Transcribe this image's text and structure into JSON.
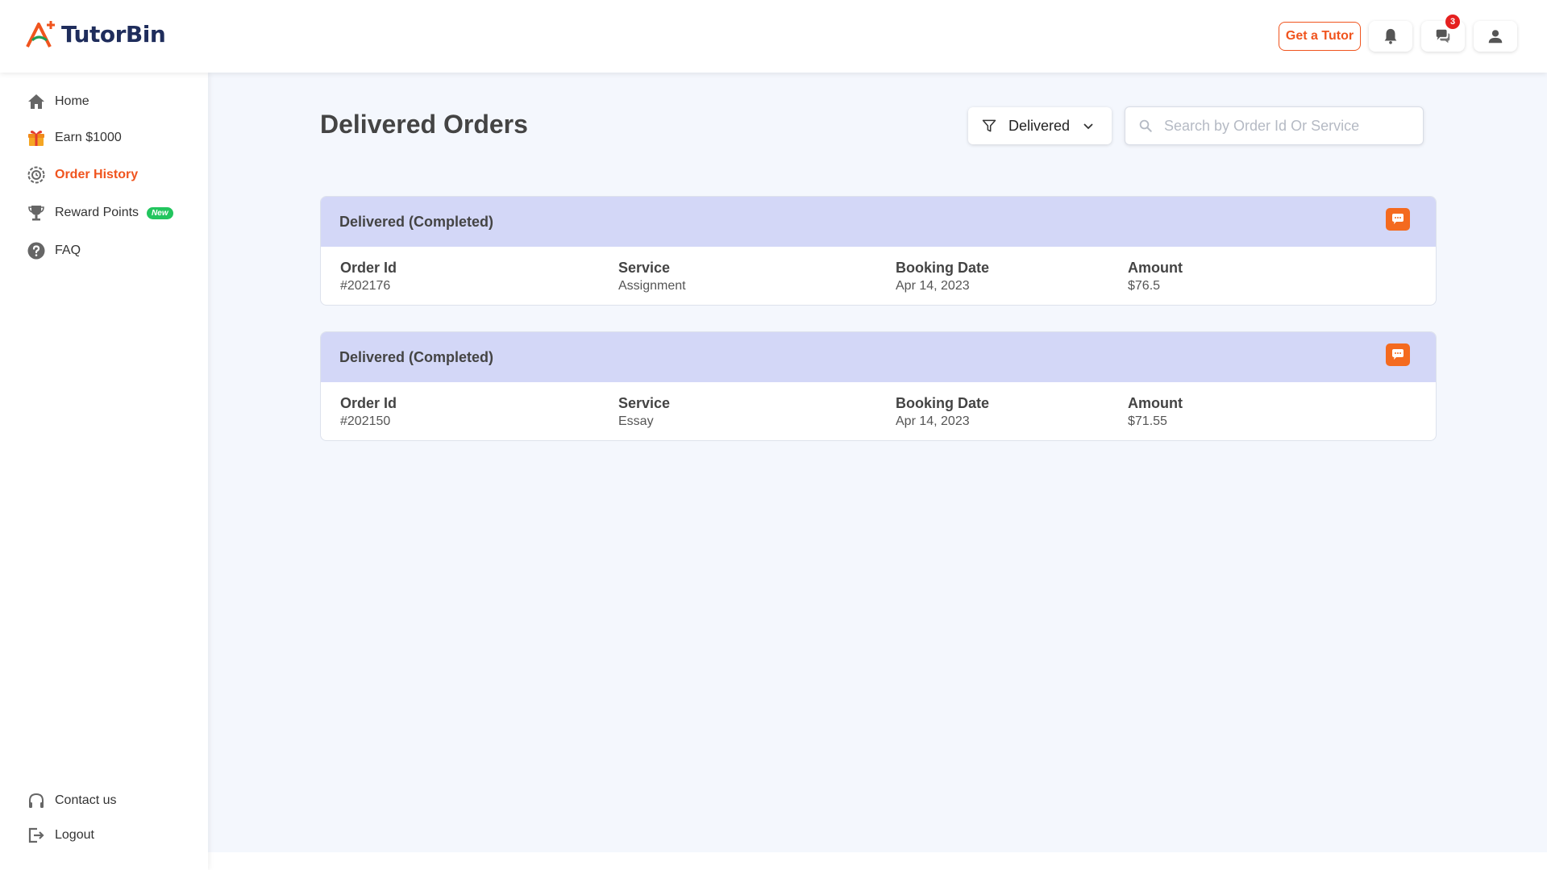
{
  "header": {
    "logo_text": "TutorBin",
    "get_tutor_label": "Get a Tutor",
    "messages_badge": "3"
  },
  "sidebar": {
    "items": [
      {
        "label": "Home",
        "icon": "home-icon"
      },
      {
        "label": "Earn $1000",
        "icon": "gift-icon"
      },
      {
        "label": "Order History",
        "icon": "order-history-icon",
        "active": true
      },
      {
        "label": "Reward Points",
        "icon": "trophy-icon",
        "badge": "New"
      },
      {
        "label": "FAQ",
        "icon": "question-icon"
      }
    ],
    "bottom_items": [
      {
        "label": "Contact us",
        "icon": "headphones-icon"
      },
      {
        "label": "Logout",
        "icon": "logout-icon"
      }
    ]
  },
  "main": {
    "title": "Delivered Orders",
    "filter_value": "Delivered",
    "search_placeholder": "Search by Order Id Or Service",
    "columns": {
      "order_id": "Order Id",
      "service": "Service",
      "booking_date": "Booking Date",
      "amount": "Amount"
    },
    "orders": [
      {
        "status": "Delivered (Completed)",
        "order_id": "#202176",
        "service": "Assignment",
        "booking_date": "Apr 14, 2023",
        "amount": "$76.5"
      },
      {
        "status": "Delivered (Completed)",
        "order_id": "#202150",
        "service": "Essay",
        "booking_date": "Apr 14, 2023",
        "amount": "$71.55"
      }
    ]
  },
  "colors": {
    "accent": "#f0541e",
    "card_header": "#d3d7f7",
    "background": "#f4f7fd",
    "new_badge": "#22c55e"
  }
}
